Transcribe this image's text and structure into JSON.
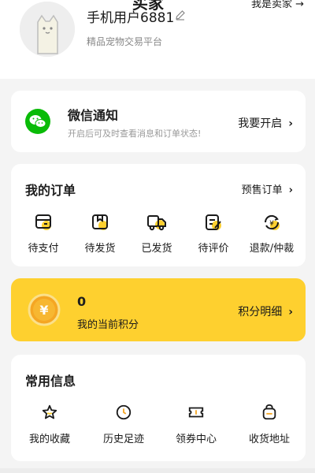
{
  "header": {
    "title": "买家",
    "switch_label": "我是卖家 →",
    "username": "手机用户6881",
    "edit_icon": "pencil-icon",
    "platform": "精品宠物交易平台"
  },
  "wechat": {
    "icon": "wechat-icon",
    "title": "微信通知",
    "desc": "开启后可及时查看消息和订单状态!",
    "action": "我要开启"
  },
  "orders": {
    "title": "我的订单",
    "presale": "预售订单",
    "items": [
      {
        "label": "待支付",
        "icon": "wallet-icon"
      },
      {
        "label": "待发货",
        "icon": "box-icon"
      },
      {
        "label": "已发货",
        "icon": "truck-icon"
      },
      {
        "label": "待评价",
        "icon": "review-icon"
      },
      {
        "label": "退款/仲裁",
        "icon": "refund-icon"
      }
    ]
  },
  "points": {
    "value": "0",
    "label": "我的当前积分",
    "detail": "积分明细",
    "icon": "coin-icon"
  },
  "common": {
    "title": "常用信息",
    "items": [
      {
        "label": "我的收藏",
        "icon": "star-icon"
      },
      {
        "label": "历史足迹",
        "icon": "clock-icon"
      },
      {
        "label": "领券中心",
        "icon": "coupon-icon"
      },
      {
        "label": "收货地址",
        "icon": "address-icon"
      }
    ]
  },
  "colors": {
    "accent": "#fed02f",
    "wechat_green": "#09bb07",
    "background": "#f4f4f4",
    "card": "#ffffff"
  }
}
